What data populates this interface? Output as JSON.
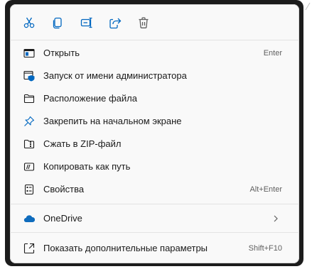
{
  "toolbar": {
    "icons": [
      "cut-icon",
      "copy-icon",
      "rename-icon",
      "share-icon",
      "delete-icon"
    ]
  },
  "items": [
    {
      "label": "Открыть",
      "shortcut": "Enter",
      "icon": "open-app-icon"
    },
    {
      "label": "Запуск от имени администратора",
      "shortcut": "",
      "icon": "run-as-admin-icon"
    },
    {
      "label": "Расположение файла",
      "shortcut": "",
      "icon": "folder-icon"
    },
    {
      "label": "Закрепить на начальном экране",
      "shortcut": "",
      "icon": "pin-icon"
    },
    {
      "label": "Сжать в ZIP-файл",
      "shortcut": "",
      "icon": "zip-icon"
    },
    {
      "label": "Копировать как путь",
      "shortcut": "",
      "icon": "copy-path-icon"
    },
    {
      "label": "Свойства",
      "shortcut": "Alt+Enter",
      "icon": "properties-icon"
    }
  ],
  "onedrive": {
    "label": "OneDrive",
    "icon": "onedrive-cloud-icon"
  },
  "more": {
    "label": "Показать дополнительные параметры",
    "shortcut": "Shift+F10",
    "icon": "more-options-icon"
  },
  "colors": {
    "accent": "#0067c0",
    "text": "#1a1a1a",
    "shortcut": "#5f5f5f",
    "menu_bg": "#f9f9f9",
    "frame": "#1c1c1c"
  }
}
